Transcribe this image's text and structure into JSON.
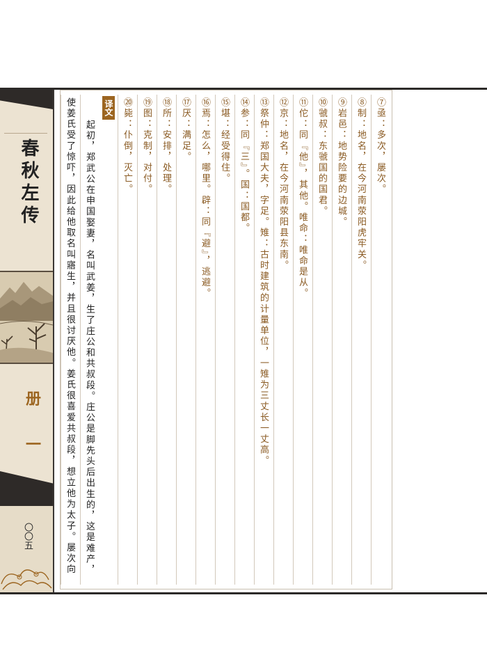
{
  "book": {
    "title": "春秋左传",
    "volume": "册 一",
    "page_number": "〇〇五"
  },
  "translation": {
    "label": "译文",
    "lines": [
      "起初，郑武公在申国娶妻，名叫武姜，生了庄公和共叔段。庄公是脚先头后出生的，这是难产，",
      "使姜氏受了惊吓，因此给他取名叫寤生，并且很讨厌他。姜氏很喜爱共叔段，想立他为太子。屡次向"
    ]
  },
  "notes": [
    "⑦亟：多次，屡次。",
    "⑧制：地名，在今河南荥阳虎牢关。",
    "⑨岩邑：地势险要的边城。",
    "⑩虢叔：东虢国的国君。",
    "⑪佗：同『他』，其他。唯命：唯命是从。",
    "⑫京：地名，在今河南荥阳县东南。",
    "⑬祭仲：郑国大夫，字足。雉：古时建筑的计量单位，一雉为三丈长一丈高。",
    "⑭参：同『三』。国：国都。",
    "⑮堪：经受得住。",
    "⑯焉：怎么，哪里。辟：同『避』，逃避。",
    "⑰厌：满足。",
    "⑱所：安排，处理。",
    "⑲图：克制，对付。",
    "⑳毙：仆倒，灭亡。"
  ],
  "colors": {
    "accent": "#9c6520",
    "note_text": "#8a5a22",
    "frame": "#2c2a28",
    "band_bg": "#ece3d2"
  }
}
